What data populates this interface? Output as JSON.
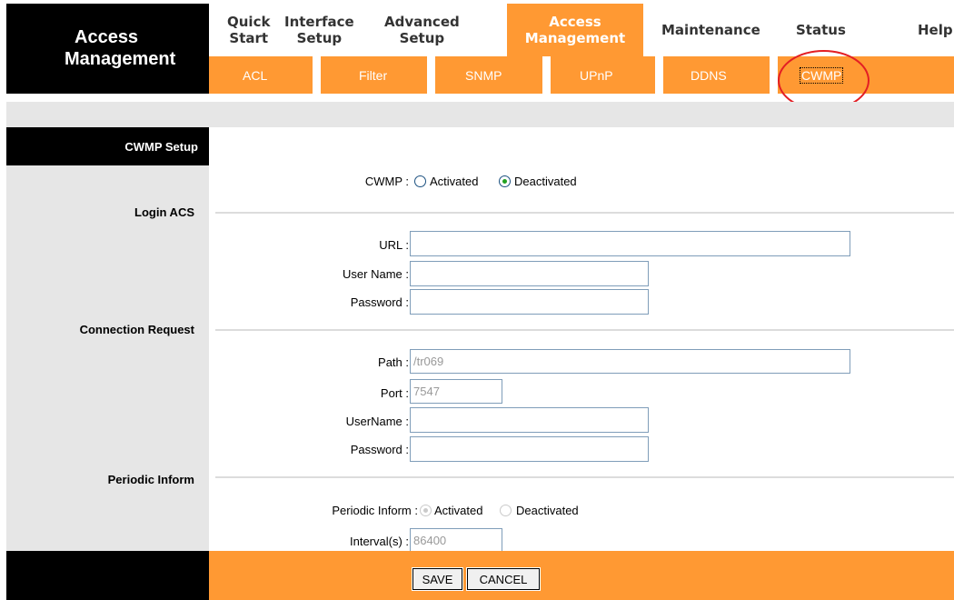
{
  "brand": {
    "line1": "Access",
    "line2": "Management"
  },
  "nav": {
    "tabs": [
      {
        "line1": "Quick",
        "line2": "Start"
      },
      {
        "line1": "Interface",
        "line2": "Setup"
      },
      {
        "line1": "Advanced",
        "line2": "Setup"
      },
      {
        "line1": "Access",
        "line2": "Management",
        "active": true
      },
      {
        "line1": "Maintenance",
        "line2": ""
      },
      {
        "line1": "Status",
        "line2": ""
      },
      {
        "line1": "Help",
        "line2": ""
      }
    ]
  },
  "subnav": {
    "items": [
      "ACL",
      "Filter",
      "SNMP",
      "UPnP",
      "DDNS",
      "CWMP"
    ],
    "active": "CWMP"
  },
  "sections": {
    "setup": "CWMP Setup",
    "login": "Login ACS",
    "connection": "Connection Request",
    "periodic": "Periodic Inform"
  },
  "cwmp": {
    "label": "CWMP :",
    "option_activated": "Activated",
    "option_deactivated": "Deactivated",
    "selected": "Deactivated"
  },
  "login_acs": {
    "url_label": "URL :",
    "url_value": "",
    "username_label": "User Name :",
    "username_value": "",
    "password_label": "Password :",
    "password_value": ""
  },
  "connection_request": {
    "path_label": "Path :",
    "path_value": "/tr069",
    "port_label": "Port :",
    "port_value": "7547",
    "username_label": "UserName :",
    "username_value": "",
    "password_label": "Password :",
    "password_value": ""
  },
  "periodic_inform": {
    "label": "Periodic Inform :",
    "option_activated": "Activated",
    "option_deactivated": "Deactivated",
    "selected": "Activated",
    "interval_label": "Interval(s) :",
    "interval_value": "86400"
  },
  "buttons": {
    "save": "SAVE",
    "cancel": "CANCEL"
  },
  "colors": {
    "accent": "#ff9933",
    "header_dark": "#000000",
    "panel_grey": "#e6e6e6",
    "highlight": "#e31e24"
  }
}
